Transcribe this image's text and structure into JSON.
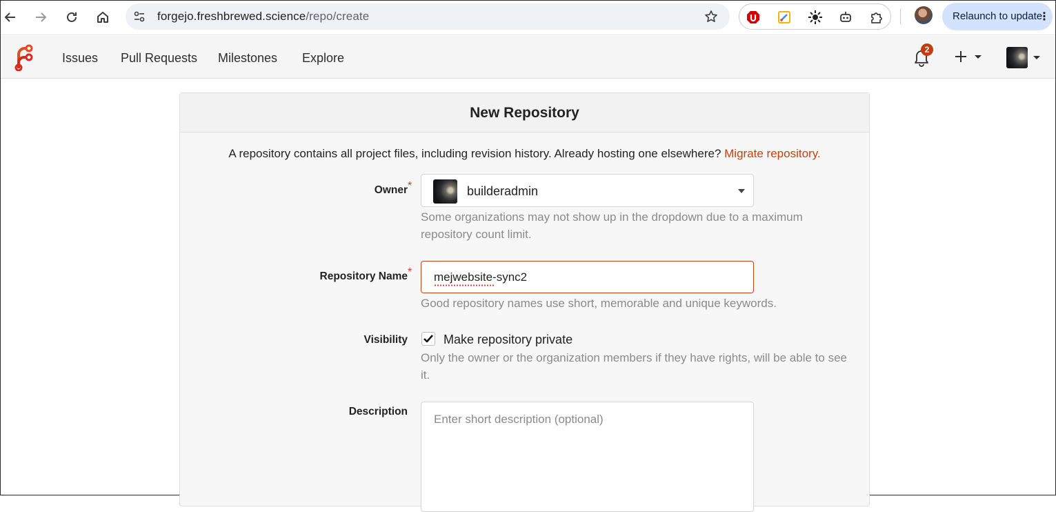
{
  "browser": {
    "url_host": "forgejo.freshbrewed.science",
    "url_path": "/repo/create",
    "relaunch_label": "Relaunch to update",
    "icons": [
      "back-icon",
      "forward-icon",
      "reload-icon",
      "home-icon",
      "site-settings-icon",
      "star-icon",
      "ublock-icon",
      "color-picker-icon",
      "sun-extension-icon",
      "robot-extension-icon",
      "extensions-puzzle-icon",
      "kebab-menu-icon"
    ]
  },
  "app_nav": {
    "links": [
      "Issues",
      "Pull Requests",
      "Milestones",
      "Explore"
    ],
    "notification_count": "2",
    "brand_color": "#c5410f"
  },
  "form": {
    "title": "New Repository",
    "intro_text": "A repository contains all project files, including revision history. Already hosting one elsewhere?",
    "intro_link": "Migrate repository.",
    "owner": {
      "label": "Owner",
      "required_mark": "*",
      "value": "builderadmin",
      "help": "Some organizations may not show up in the dropdown due to a maximum repository count limit."
    },
    "repo_name": {
      "label": "Repository Name",
      "required_mark": "*",
      "value": "mejwebsite-sync2",
      "help": "Good repository names use short, memorable and unique keywords."
    },
    "visibility": {
      "label": "Visibility",
      "checkbox_label": "Make repository private",
      "checked": true,
      "help": "Only the owner or the organization members if they have rights, will be able to see it."
    },
    "description": {
      "label": "Description",
      "placeholder": "Enter short description (optional)"
    }
  }
}
